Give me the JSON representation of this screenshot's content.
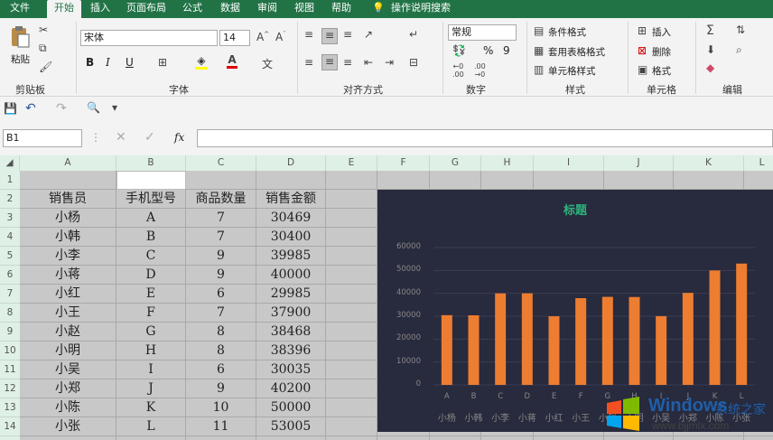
{
  "tabs": [
    "文件",
    "开始",
    "插入",
    "页面布局",
    "公式",
    "数据",
    "审阅",
    "视图",
    "帮助",
    "操作说明搜索"
  ],
  "ribbon": {
    "clipboard": {
      "paste": "粘贴",
      "label": "剪贴板"
    },
    "font": {
      "name": "宋体",
      "size": "14",
      "label": "字体",
      "bold": "B",
      "italic": "I",
      "underline": "U"
    },
    "align": {
      "label": "对齐方式"
    },
    "number": {
      "format": "常规",
      "label": "数字",
      "percent": "%",
      "comma": "9"
    },
    "styles": {
      "cond": "条件格式",
      "table": "套用表格格式",
      "cell": "单元格样式",
      "label": "样式"
    },
    "cells": {
      "insert": "插入",
      "delete": "删除",
      "format": "格式",
      "label": "单元格"
    },
    "edit": {
      "label": "编辑"
    }
  },
  "namebox": "B1",
  "fx": "fx",
  "columns": [
    "A",
    "B",
    "C",
    "D",
    "E",
    "F",
    "G",
    "H",
    "I",
    "J",
    "K",
    "L"
  ],
  "rows": [
    "1",
    "2",
    "3",
    "4",
    "5",
    "6",
    "7",
    "8",
    "9",
    "10",
    "11",
    "12",
    "13",
    "14"
  ],
  "table": {
    "headers": [
      "销售员",
      "手机型号",
      "商品数量",
      "销售金额"
    ],
    "data": [
      [
        "小杨",
        "A",
        "7",
        "30469"
      ],
      [
        "小韩",
        "B",
        "7",
        "30400"
      ],
      [
        "小李",
        "C",
        "9",
        "39985"
      ],
      [
        "小蒋",
        "D",
        "9",
        "40000"
      ],
      [
        "小红",
        "E",
        "6",
        "29985"
      ],
      [
        "小王",
        "F",
        "7",
        "37900"
      ],
      [
        "小赵",
        "G",
        "8",
        "38468"
      ],
      [
        "小明",
        "H",
        "8",
        "38396"
      ],
      [
        "小吴",
        "I",
        "6",
        "30035"
      ],
      [
        "小郑",
        "J",
        "9",
        "40200"
      ],
      [
        "小陈",
        "K",
        "10",
        "50000"
      ],
      [
        "小张",
        "L",
        "11",
        "53005"
      ]
    ]
  },
  "chart_data": {
    "type": "bar",
    "title": "标题",
    "categories": [
      "A",
      "B",
      "C",
      "D",
      "E",
      "F",
      "G",
      "H",
      "I",
      "J",
      "K",
      "L"
    ],
    "categories2": [
      "小杨",
      "小韩",
      "小李",
      "小蒋",
      "小红",
      "小王",
      "小赵",
      "小明",
      "小吴",
      "小郑",
      "小陈",
      "小张"
    ],
    "values": [
      30469,
      30400,
      39985,
      40000,
      29985,
      37900,
      38468,
      38396,
      30035,
      40200,
      50000,
      53005
    ],
    "ylim": [
      0,
      60000
    ],
    "yticks": [
      "60000",
      "50000",
      "40000",
      "30000",
      "20000",
      "10000",
      "0"
    ],
    "bar_color": "#ed7d31",
    "background": "#282a3d",
    "title_color": "#2fb37d"
  },
  "watermark": {
    "line1": "Windows",
    "line2": "系统之家",
    "url": "www.bjjmlx.com"
  }
}
